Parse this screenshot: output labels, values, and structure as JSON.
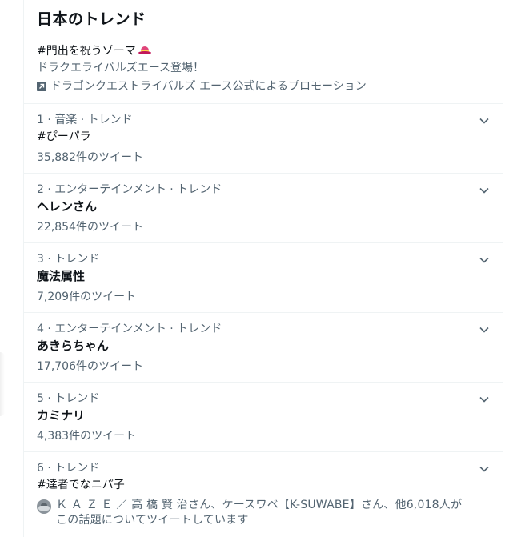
{
  "section_title": "日本のトレンド",
  "promoted": {
    "hashtag": "#門出を祝うゾーマ",
    "description": "ドラクエライバルズエース登場！",
    "promoted_by": "ドラゴンクエストライバルズ エース公式によるプロモーション",
    "icon": "party-cap-icon"
  },
  "trends": [
    {
      "meta": "1 · 音楽 · トレンド",
      "name": "#ぴーパラ",
      "count": "35,882件のツイート"
    },
    {
      "meta": "2 · エンターテインメント · トレンド",
      "name": "ヘレンさん",
      "count": "22,854件のツイート"
    },
    {
      "meta": "3 · トレンド",
      "name": "魔法属性",
      "count": "7,209件のツイート"
    },
    {
      "meta": "4 · エンターテインメント · トレンド",
      "name": "あきらちゃん",
      "count": "17,706件のツイート"
    },
    {
      "meta": "5 · トレンド",
      "name": "カミナリ",
      "count": "4,383件のツイート"
    },
    {
      "meta": "6 · トレンド",
      "name": "#達者でなニパ子",
      "context_line1": "Ｋ Ａ Ｚ Ｅ ／ 高 橋 賢 治さん、ケースワベ【K-SUWABE】さん、他6,018人が",
      "context_line2": "この話題についてツイートしています"
    }
  ],
  "colors": {
    "text_primary": "#0f1419",
    "text_secondary": "#536471",
    "divider": "#eff3f4"
  }
}
